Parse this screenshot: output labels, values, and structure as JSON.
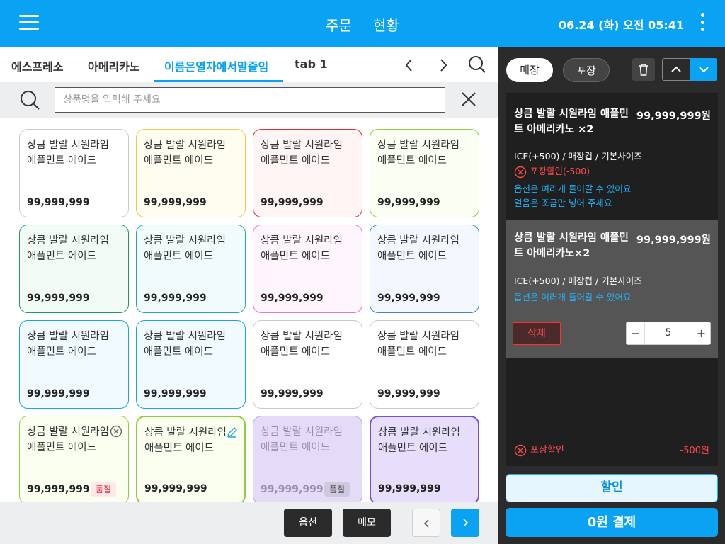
{
  "header": {
    "tabs": [
      "주문",
      "현황"
    ],
    "datetime": "06.24 (화) 오전 05:41"
  },
  "categories": {
    "tabs": [
      "에스프레소",
      "아메리카노",
      "이름은열자에서말줄임",
      "tab 1"
    ],
    "active_index": 2
  },
  "search": {
    "placeholder": "상품명을 입력해 주세요",
    "value": ""
  },
  "products": [
    {
      "name": "상큼 발랄 시원라임\n애플민트 에이드",
      "price": "99,999,999",
      "border": "#c9c9c9",
      "bg": "#ffffff"
    },
    {
      "name": "상큼 발랄 시원라임\n애플민트 에이드",
      "price": "99,999,999",
      "border": "#f2c84b",
      "bg": "#fffcf0"
    },
    {
      "name": "상큼 발랄 시원라임\n애플민트 에이드",
      "price": "99,999,999",
      "border": "#e0303a",
      "bg": "#fff5f5"
    },
    {
      "name": "상큼 발랄 시원라임\n애플민트 에이드",
      "price": "99,999,999",
      "border": "#8fcf3c",
      "bg": "#fbfff3"
    },
    {
      "name": "상큼 발랄 시원라임\n애플민트 에이드",
      "price": "99,999,999",
      "border": "#1e9b5e",
      "bg": "#f2fbf6"
    },
    {
      "name": "상큼 발랄 시원라임\n애플민트 에이드",
      "price": "99,999,999",
      "border": "#2aa6a6",
      "bg": "#f1fbfb"
    },
    {
      "name": "상큼 발랄 시원라임\n애플민트 에이드",
      "price": "99,999,999",
      "border": "#e874d6",
      "bg": "#fff5fd"
    },
    {
      "name": "상큼 발랄 시원라임\n애플민트 에이드",
      "price": "99,999,999",
      "border": "#3d86d6",
      "bg": "#f3f8ff"
    },
    {
      "name": "상큼 발랄 시원라임\n애플민트 에이드",
      "price": "99,999,999",
      "border": "#1aa7d8",
      "bg": "#f1fbff"
    },
    {
      "name": "상큼 발랄 시원라임\n애플민트 에이드",
      "price": "99,999,999",
      "border": "#1aa7d8",
      "bg": "#f1fbff"
    },
    {
      "name": "상큼 발랄 시원라임\n애플민트 에이드",
      "price": "99,999,999",
      "border": "#c9c9c9",
      "bg": "#ffffff"
    },
    {
      "name": "상큼 발랄 시원라임\n애플민트 에이드",
      "price": "99,999,999",
      "border": "#c9c9c9",
      "bg": "#ffffff"
    },
    {
      "name": "상큼 발랄 시원라임\n애플민트 에이드",
      "price": "99,999,999",
      "border": "#8fcf3c",
      "bg": "#fbfff0",
      "badge": "품절",
      "icon": "x-circle-icon"
    },
    {
      "name": "상큼 발랄 시원라임\n애플민트 에이드",
      "price": "99,999,999",
      "border": "#8fcf3c",
      "bg": "#fbfff0",
      "border_width": 2.2,
      "icon": "pencil-icon"
    },
    {
      "name": "상큼 발랄 시원라임\n애플민트 에이드",
      "price": "99,999,999",
      "border": "#b7a4e6",
      "bg": "#e4dcf7",
      "badge": "품절",
      "disabled": true
    },
    {
      "name": "상큼 발랄 시원라임\n애플민트 에이드",
      "price": "99,999,999",
      "border": "#7b4fd6",
      "bg": "#e6defb",
      "border_width": 2.2
    }
  ],
  "bottom": {
    "option_label": "옵션",
    "memo_label": "메모"
  },
  "order": {
    "dine_in": "매장",
    "takeout": "포장",
    "items": [
      {
        "name": "상큼 발랄 시원라임 애플민트 아메리카노 ×2",
        "price": "99,999,999원",
        "options": "ICE(+500) / 매장컵 / 기본사이즈",
        "discount": "포장할인(-500)",
        "notes": [
          "옵션은 여러개 들어갈 수 있어요",
          "얼음은 조금만 넣어 주세요"
        ]
      },
      {
        "name": "상큼 발랄 시원라임 애플민트 아메리카노×2",
        "price": "99,999,999원",
        "options": "ICE(+500) / 매장컵 / 기본사이즈",
        "notes": [
          "옵션은 여러개 들어갈 수 있어요"
        ],
        "delete_label": "삭제",
        "quantity": "5"
      }
    ],
    "discount_label": "포장할인",
    "discount_amount": "-500원",
    "discount_button": "할인",
    "pay_button": "0원 결제"
  },
  "colors": {
    "accent": "#0aa2f2",
    "danger": "#ff4a4a",
    "dark": "#2b2b2b"
  }
}
